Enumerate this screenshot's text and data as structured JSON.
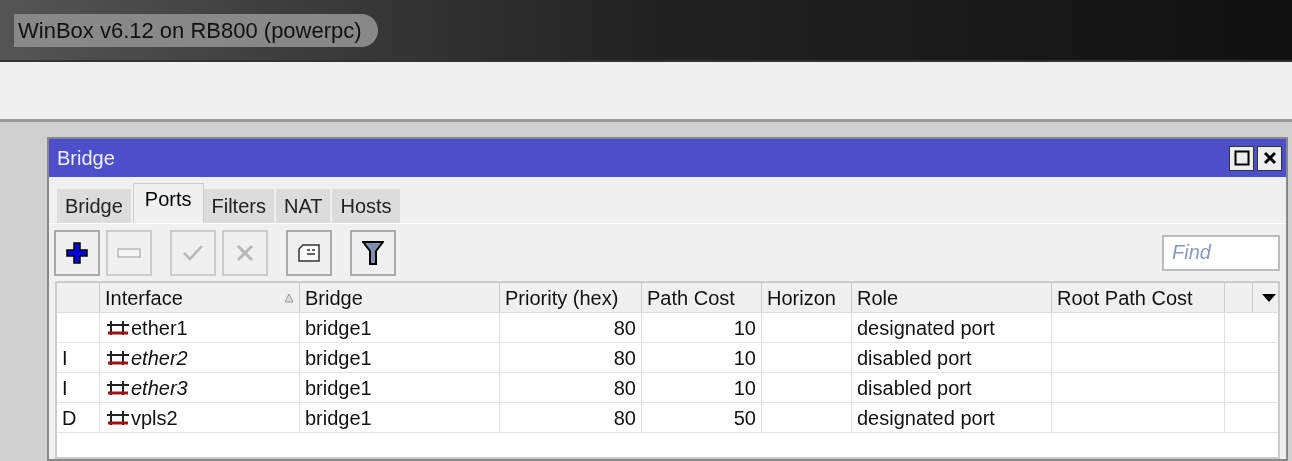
{
  "app_title": "WinBox v6.12 on RB800 (powerpc)",
  "window": {
    "title": "Bridge",
    "controls": [
      {
        "kind": "maximize"
      },
      {
        "kind": "close"
      }
    ]
  },
  "tabs": [
    {
      "label": "Bridge",
      "selected": false
    },
    {
      "label": "Ports",
      "selected": true
    },
    {
      "label": "Filters",
      "selected": false
    },
    {
      "label": "NAT",
      "selected": false
    },
    {
      "label": "Hosts",
      "selected": false
    }
  ],
  "toolbar": [
    {
      "kind": "add",
      "disabled": false
    },
    {
      "kind": "remove",
      "disabled": true
    },
    {
      "kind": "enable",
      "disabled": true
    },
    {
      "kind": "disable",
      "disabled": true
    },
    {
      "kind": "comment",
      "disabled": false
    },
    {
      "kind": "filter",
      "disabled": false
    }
  ],
  "search": {
    "placeholder": "Find"
  },
  "table": {
    "columns": [
      {
        "label": "Interface",
        "kind": "text",
        "sorted": true
      },
      {
        "label": "Bridge",
        "kind": "text",
        "sorted": false
      },
      {
        "label": "Priority (hex)",
        "kind": "number",
        "sorted": false
      },
      {
        "label": "Path Cost",
        "kind": "number",
        "sorted": false
      },
      {
        "label": "Horizon",
        "kind": "text",
        "sorted": false
      },
      {
        "label": "Role",
        "kind": "text",
        "sorted": false
      },
      {
        "label": "Root Path Cost",
        "kind": "text",
        "sorted": false
      }
    ],
    "rows": [
      {
        "inactive": false,
        "cells": [
          "ether1",
          "bridge1",
          "80",
          "10",
          "",
          "designated port",
          ""
        ]
      },
      {
        "flag": "I",
        "inactive": true,
        "cells": [
          "ether2",
          "bridge1",
          "80",
          "10",
          "",
          "disabled port",
          ""
        ]
      },
      {
        "flag": "I",
        "inactive": true,
        "cells": [
          "ether3",
          "bridge1",
          "80",
          "10",
          "",
          "disabled port",
          ""
        ]
      },
      {
        "flag": "D",
        "inactive": false,
        "cells": [
          "vpls2",
          "bridge1",
          "80",
          "50",
          "",
          "designated port",
          ""
        ]
      }
    ]
  }
}
